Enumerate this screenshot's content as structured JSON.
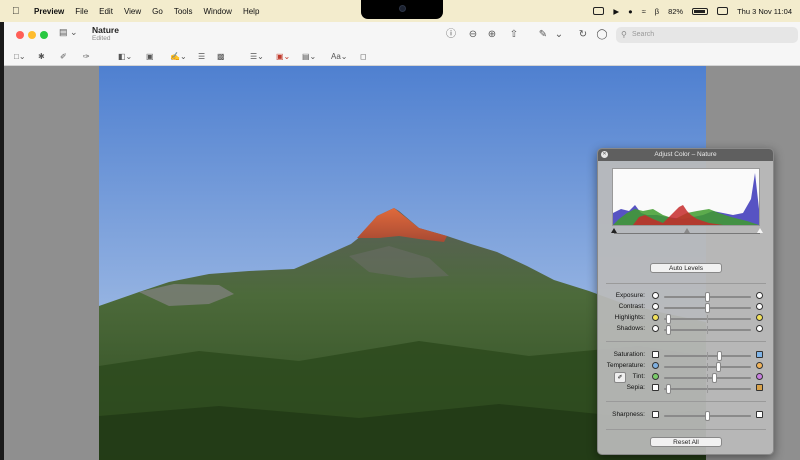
{
  "menubar": {
    "app": "Preview",
    "items": [
      "File",
      "Edit",
      "View",
      "Go",
      "Tools",
      "Window",
      "Help"
    ],
    "battery": "82%",
    "clock": "Thu 3 Nov  11:04"
  },
  "window": {
    "title": "Nature",
    "subtitle": "Edited",
    "search_placeholder": "Search"
  },
  "panel": {
    "title": "Adjust Color – Nature",
    "auto_levels_label": "Auto Levels",
    "reset_label": "Reset All",
    "levels": {
      "black": 0.0,
      "mid": 0.5,
      "white": 1.0
    },
    "groups": [
      [
        {
          "label": "Exposure:",
          "value": 0.5
        },
        {
          "label": "Contrast:",
          "value": 0.5
        },
        {
          "label": "Highlights:",
          "value": 0.02
        },
        {
          "label": "Shadows:",
          "value": 0.02
        }
      ],
      [
        {
          "label": "Saturation:",
          "value": 0.65
        },
        {
          "label": "Temperature:",
          "value": 0.63
        },
        {
          "label": "Tint:",
          "value": 0.58
        },
        {
          "label": "Sepia:",
          "value": 0.02
        }
      ],
      [
        {
          "label": "Sharpness:",
          "value": 0.5
        }
      ]
    ]
  },
  "colors": {
    "menubar": "#f3eccd",
    "sky_top": "#4e7fd0",
    "sky_bottom": "#b7cbe6",
    "peak": "#d35a36",
    "forest": "#3d5a2c"
  }
}
